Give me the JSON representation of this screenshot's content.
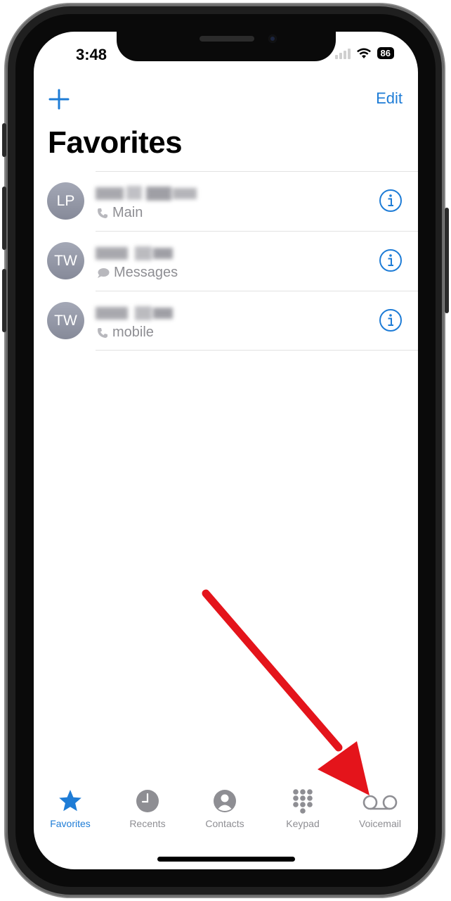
{
  "status_bar": {
    "time": "3:48",
    "battery": "86"
  },
  "nav": {
    "add_icon": "plus-icon",
    "edit_label": "Edit"
  },
  "title": "Favorites",
  "favorites": [
    {
      "initials": "LP",
      "label": "Main",
      "label_icon": "phone-icon"
    },
    {
      "initials": "TW",
      "label": "Messages",
      "label_icon": "message-icon"
    },
    {
      "initials": "TW",
      "label": "mobile",
      "label_icon": "phone-icon"
    }
  ],
  "tabs": [
    {
      "label": "Favorites",
      "icon": "star-icon",
      "active": true
    },
    {
      "label": "Recents",
      "icon": "clock-icon",
      "active": false
    },
    {
      "label": "Contacts",
      "icon": "person-icon",
      "active": false
    },
    {
      "label": "Keypad",
      "icon": "keypad-icon",
      "active": false
    },
    {
      "label": "Voicemail",
      "icon": "voicemail-icon",
      "active": false
    }
  ],
  "colors": {
    "accent": "#1e7cd6",
    "annotation_arrow": "#e4141b",
    "inactive": "#8e8e93"
  }
}
